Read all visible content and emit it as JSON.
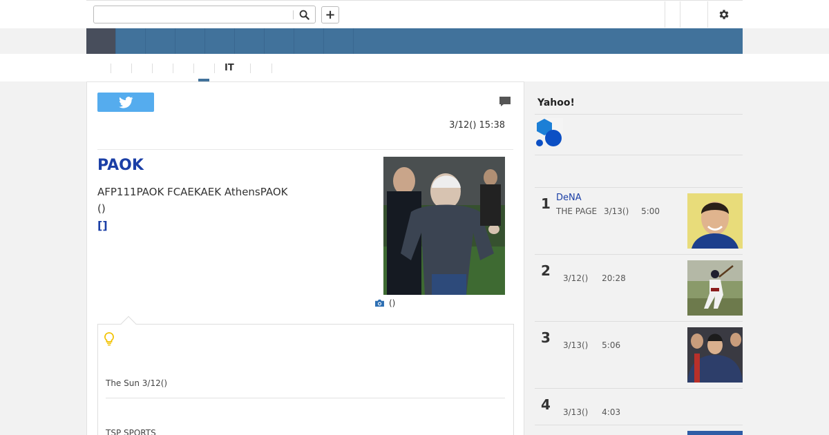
{
  "header": {
    "search": {
      "value": "",
      "placeholder": ""
    },
    "plus_label": "+"
  },
  "nav": {
    "active_index": 0,
    "item_count": 9
  },
  "subnav": {
    "items": [
      "",
      "",
      "",
      "",
      "",
      "IT",
      "",
      ""
    ],
    "active_index": 4
  },
  "article": {
    "date": "3/12() 15:38",
    "title": "PAOK",
    "body_line1": "AFP111PAOK FCAEKAEK AthensPAOK",
    "body_line2": "()",
    "more_link": "[]",
    "photo_caption": "()"
  },
  "tips": {
    "source1": "The Sun 3/12()",
    "source2": "TSP SPORTS"
  },
  "sidebar": {
    "title": "Yahoo!",
    "ranking": [
      {
        "rank": "1",
        "title": "DeNA",
        "source": "THE PAGE",
        "date": "3/13()",
        "time": "5:00"
      },
      {
        "rank": "2",
        "title": "",
        "source": "",
        "date": "3/12()",
        "time": "20:28"
      },
      {
        "rank": "3",
        "title": "",
        "source": "",
        "date": "3/13()",
        "time": "5:06"
      },
      {
        "rank": "4",
        "title": "",
        "source": "",
        "date": "3/13()",
        "time": "4:03"
      }
    ]
  },
  "colors": {
    "nav_blue": "#41729b",
    "nav_active": "#484e5c",
    "link_blue": "#1b3fa6",
    "twitter_blue": "#55acee",
    "bulb_yellow": "#f2c200"
  }
}
